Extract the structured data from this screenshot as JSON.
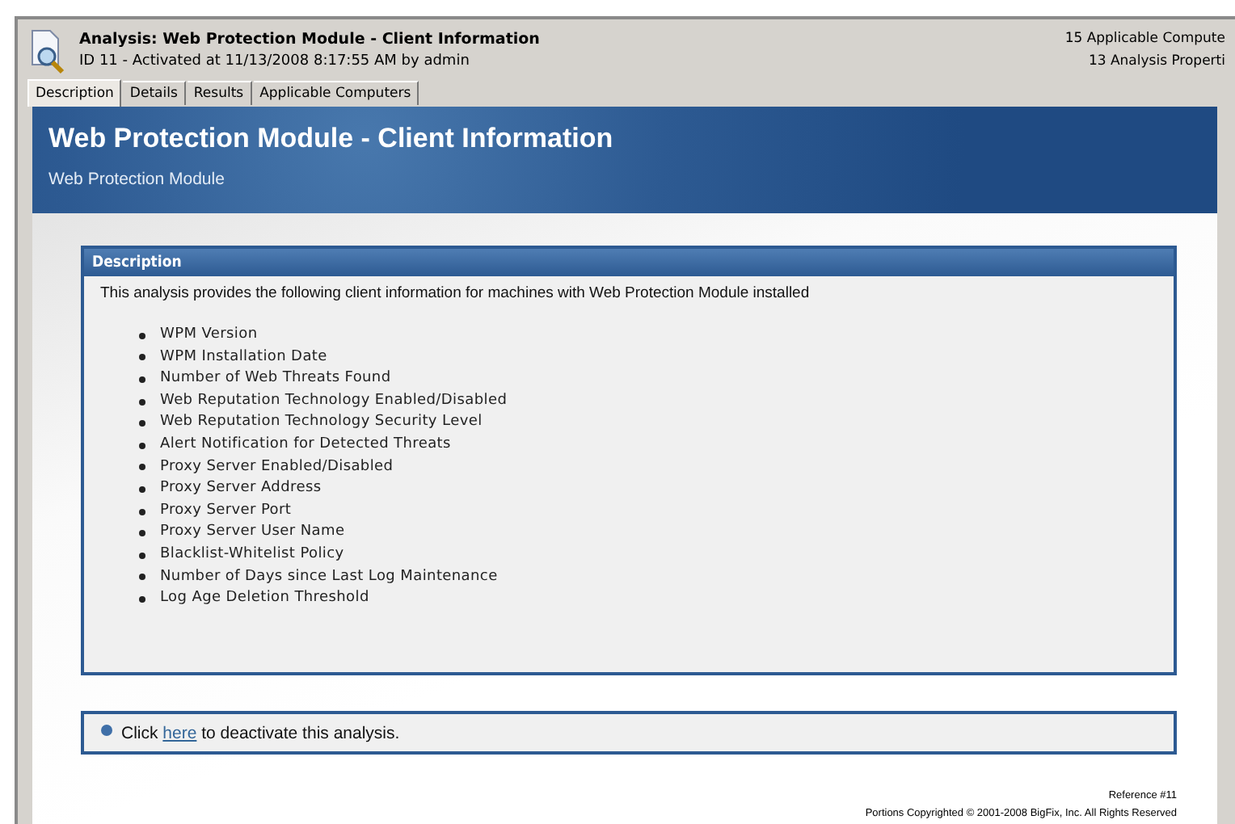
{
  "window": {
    "title": "Analysis: Web Protection Module - Client Information",
    "subtitle": "ID 11 - Activated at 11/13/2008 8:17:55 AM by admin",
    "stats": [
      "15 Applicable Compute",
      "13 Analysis Properti"
    ]
  },
  "tabs": [
    {
      "label": "Description",
      "selected": true
    },
    {
      "label": "Details",
      "selected": false
    },
    {
      "label": "Results",
      "selected": false
    },
    {
      "label": "Applicable Computers",
      "selected": false
    }
  ],
  "banner": {
    "title": "Web Protection Module - Client Information",
    "subtitle": "Web Protection Module"
  },
  "description": {
    "heading": "Description",
    "intro": "This analysis provides the following client information for machines with Web Protection Module installed",
    "items": [
      "WPM Version",
      "WPM Installation Date",
      "Number of Web Threats Found",
      "Web Reputation Technology Enabled/Disabled",
      "Web Reputation Technology Security Level",
      "Alert Notification for Detected Threats",
      "Proxy Server Enabled/Disabled",
      "Proxy Server Address",
      "Proxy Server Port",
      "Proxy Server User Name",
      "Blacklist-Whitelist Policy",
      "Number of Days since Last Log Maintenance",
      "Log Age Deletion Threshold"
    ]
  },
  "action": {
    "before": "Click",
    "link": "here",
    "after": "to deactivate this analysis."
  },
  "footer": {
    "reference": "Reference #11",
    "copyright": "Portions Copyrighted © 2001-2008 BigFix, Inc. All Rights Reserved"
  }
}
